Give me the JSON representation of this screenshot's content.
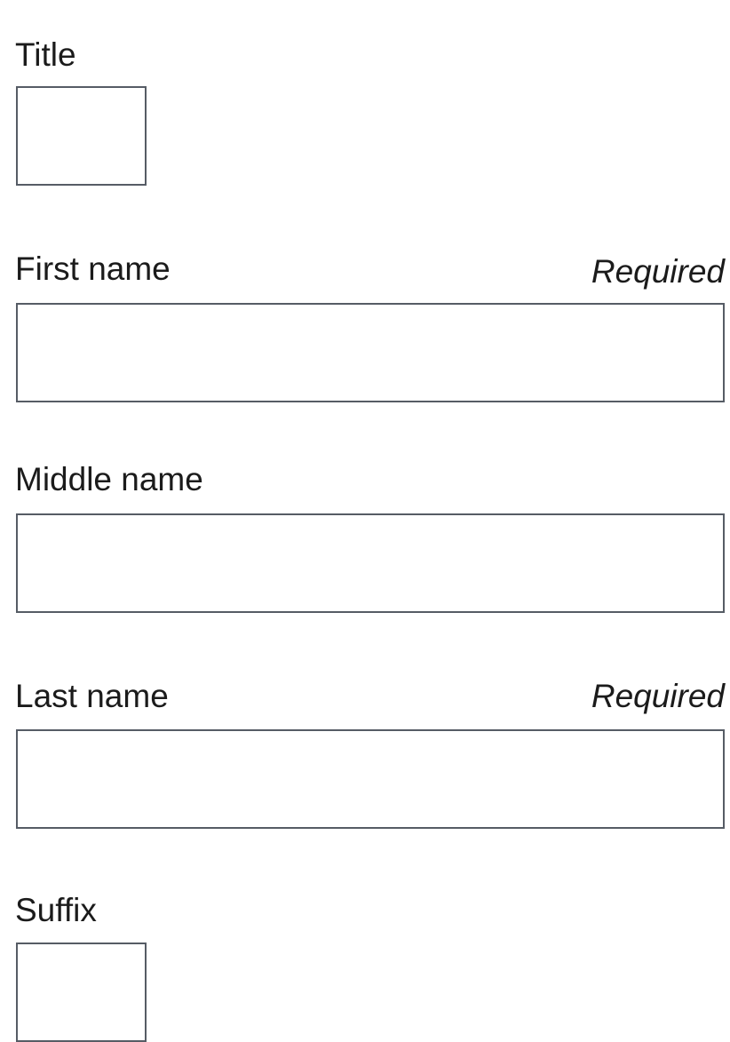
{
  "form": {
    "title": {
      "label": "Title",
      "value": "",
      "placeholder": ""
    },
    "first_name": {
      "label": "First name",
      "hint": "Required",
      "value": "",
      "placeholder": ""
    },
    "middle_name": {
      "label": "Middle name",
      "value": "",
      "placeholder": ""
    },
    "last_name": {
      "label": "Last name",
      "hint": "Required",
      "value": "",
      "placeholder": ""
    },
    "suffix": {
      "label": "Suffix",
      "value": "",
      "placeholder": ""
    }
  },
  "colors": {
    "text": "#1b1b1b",
    "input_border": "#565c65",
    "background": "#ffffff"
  }
}
